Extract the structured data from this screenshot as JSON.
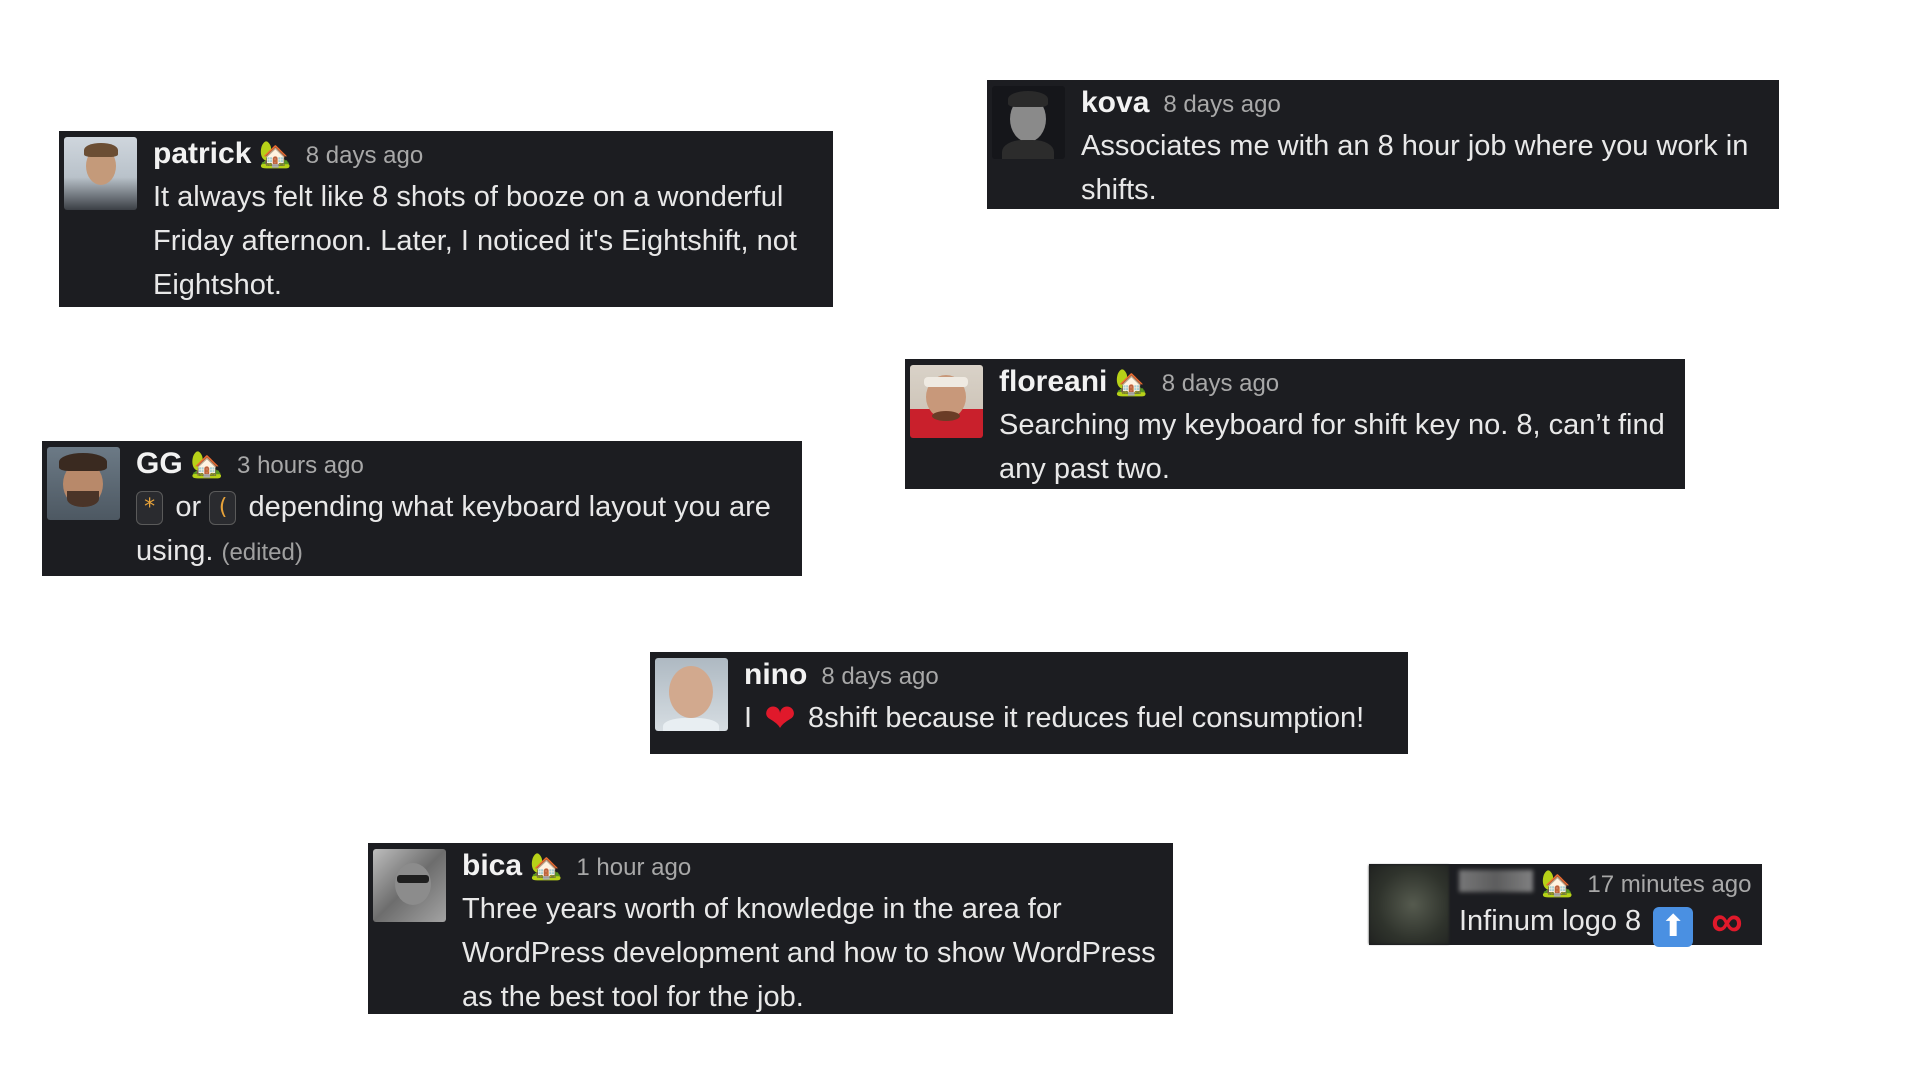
{
  "messages": [
    {
      "username": "patrick",
      "house_icon": "house-emoji",
      "timestamp": "8 days ago",
      "text": "It always felt like 8 shots of booze on a wonderful Friday afternoon. Later, I noticed it's Eightshift, not Eightshot."
    },
    {
      "username": "kova",
      "timestamp": "8 days ago",
      "text": "Associates me with an 8 hour job where you work in shifts."
    },
    {
      "username": "floreani",
      "house_icon": "house-emoji",
      "timestamp": "8 days ago",
      "text": "Searching my keyboard for shift key no. 8, can’t find any past two."
    },
    {
      "username": "GG",
      "house_icon": "house-emoji",
      "timestamp": "3 hours ago",
      "key1": "*",
      "or_word": "or",
      "key2": "(",
      "text": "depending what keyboard layout you are using.",
      "edited": "(edited)"
    },
    {
      "username": "nino",
      "timestamp": "8 days ago",
      "text_prefix": "I",
      "heart_icon": "red-heart-emoji",
      "text": "8shift because it reduces fuel consumption!"
    },
    {
      "username": "bica",
      "house_icon": "house-emoji",
      "timestamp": "1 hour ago",
      "text": "Three years worth of knowledge in the area for WordPress development and how to show WordPress as the best tool for the job."
    },
    {
      "username_blurred": true,
      "house_icon": "house-emoji",
      "timestamp": "17 minutes ago",
      "text": "Infinum logo 8",
      "arrow_icon": "up-arrow-emoji",
      "infinity_icon": "infinity-emoji"
    }
  ],
  "colors": {
    "card_bg": "#1c1d21",
    "text": "#e8e8e8",
    "timestamp": "#a8a8a8",
    "heart": "#e0192b",
    "keycap_glyph": "#e8a33a"
  }
}
